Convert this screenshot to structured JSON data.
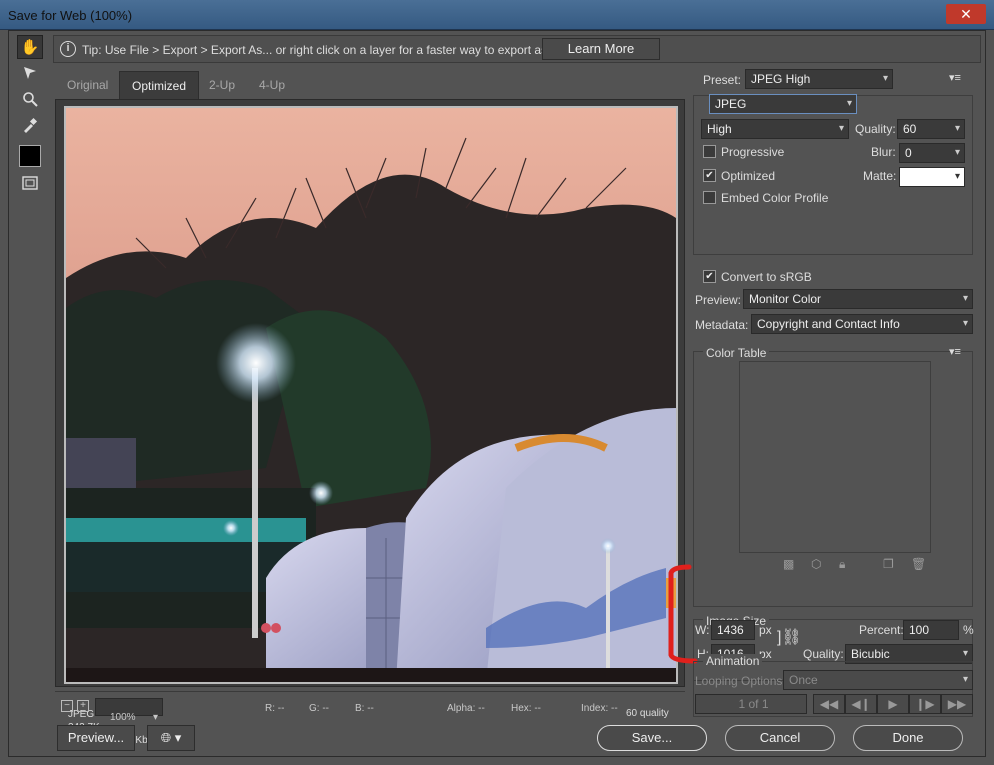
{
  "window": {
    "title": "Save for Web (100%)",
    "close_label": "✕"
  },
  "tip": {
    "text": "Tip: Use File > Export > Export As...  or right click on a layer for a faster way to export assets",
    "button": "Learn More"
  },
  "tabs": [
    "Original",
    "Optimized",
    "2-Up",
    "4-Up"
  ],
  "image_info": {
    "format": "JPEG",
    "size": "342.7K",
    "time": "63 sec @ 56.6 Kbps",
    "quality": "60 quality"
  },
  "status": {
    "zoom": "100%",
    "r": "R: --",
    "g": "G: --",
    "b": "B: --",
    "alpha": "Alpha: --",
    "hex": "Hex: --",
    "index": "Index: --"
  },
  "settings": {
    "preset_label": "Preset:",
    "preset_value": "JPEG High",
    "format_value": "JPEG",
    "compression_value": "High",
    "quality_label": "Quality:",
    "quality_value": "60",
    "progressive_label": "Progressive",
    "blur_label": "Blur:",
    "blur_value": "0",
    "optimized_label": "Optimized",
    "matte_label": "Matte:",
    "embed_label": "Embed Color Profile",
    "convert_label": "Convert to sRGB",
    "preview_label": "Preview:",
    "preview_value": "Monitor Color",
    "metadata_label": "Metadata:",
    "metadata_value": "Copyright and Contact Info",
    "progressive_checked": false,
    "optimized_checked": true,
    "embed_checked": false,
    "convert_checked": true
  },
  "color_table": {
    "title": "Color Table"
  },
  "image_size": {
    "title": "Image Size",
    "w_label": "W:",
    "w_value": "1436",
    "w_unit": "px",
    "h_label": "H:",
    "h_value": "1016",
    "h_unit": "px",
    "percent_label": "Percent:",
    "percent_value": "100",
    "percent_unit": "%",
    "quality_label": "Quality:",
    "quality_value": "Bicubic"
  },
  "animation": {
    "title": "Animation",
    "looping_label": "Looping Options:",
    "looping_value": "Once",
    "frame_counter": "1 of 1"
  },
  "buttons": {
    "preview": "Preview...",
    "save": "Save...",
    "cancel": "Cancel",
    "done": "Done"
  },
  "colors": {
    "annotation": "#e0201c",
    "bg": "#535353"
  }
}
